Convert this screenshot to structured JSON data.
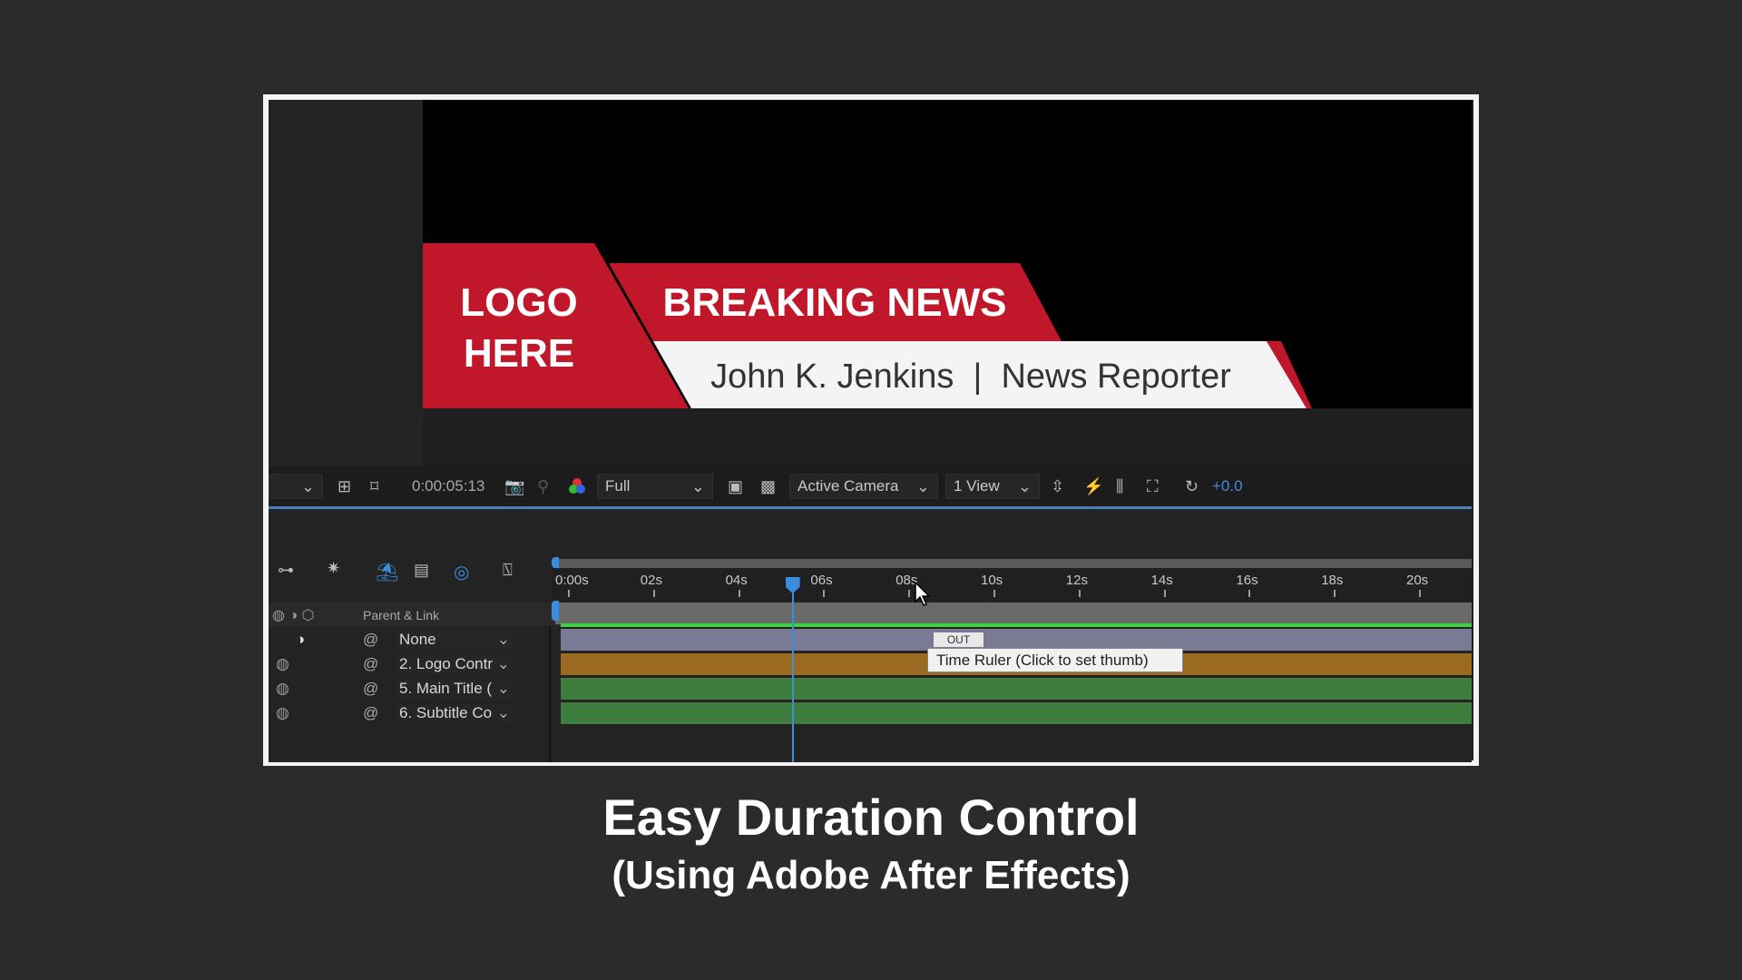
{
  "graphic": {
    "logo_line1": "LOGO",
    "logo_line2": "HERE",
    "headline": "BREAKING NEWS",
    "subtitle": "John K. Jenkins  |  News Reporter",
    "red": "#c0182a"
  },
  "toolbar": {
    "timecode": "0:00:05:13",
    "resolution": "Full",
    "camera": "Active Camera",
    "views": "1 View",
    "exposure": "+0.0"
  },
  "timeline": {
    "ticks": [
      "0:00s",
      "02s",
      "04s",
      "06s",
      "08s",
      "10s",
      "12s",
      "14s",
      "16s",
      "18s",
      "20s"
    ],
    "header": "Parent & Link",
    "rows": [
      {
        "parent": "None",
        "color": "#7a7a95"
      },
      {
        "parent": "2. Logo Contr",
        "color": "#9a6a22"
      },
      {
        "parent": "5. Main Title (",
        "color": "#3f7d3f"
      },
      {
        "parent": "6. Subtitle Co",
        "color": "#3f7d3f"
      }
    ],
    "out_label": "OUT",
    "tooltip": "Time Ruler (Click to set thumb)",
    "playhead_seconds": 5.43
  },
  "caption": {
    "title": "Easy Duration Control",
    "subtitle": "(Using Adobe After Effects)"
  }
}
